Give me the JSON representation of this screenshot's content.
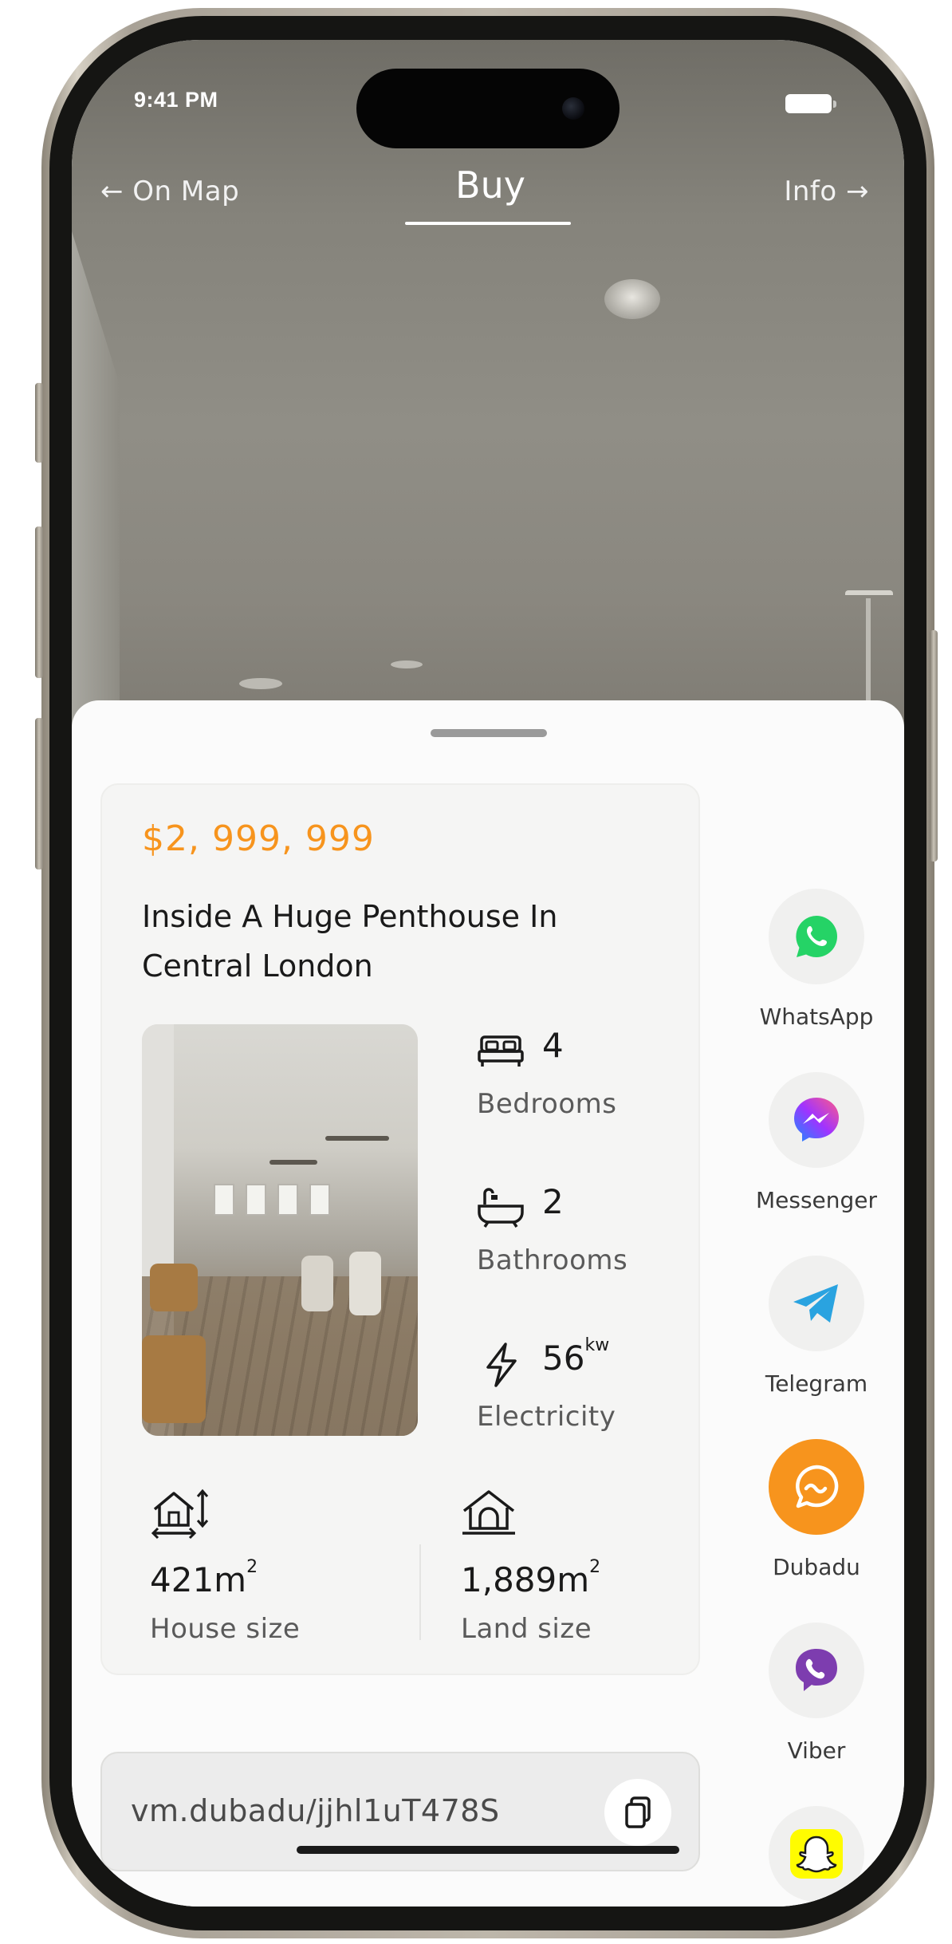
{
  "status_bar": {
    "time": "9:41 PM"
  },
  "nav": {
    "back_label": "← On Map",
    "title": "Buy",
    "info_label": "Info →"
  },
  "listing": {
    "price": "$2, 999, 999",
    "title": "Inside A Huge Penthouse In Central London",
    "bedrooms": {
      "value": "4",
      "label": "Bedrooms"
    },
    "bathrooms": {
      "value": "2",
      "label": "Bathrooms"
    },
    "electricity": {
      "value": "56",
      "unit": "kw",
      "label": "Electricity"
    },
    "house_size": {
      "value": "421m",
      "unit": "2",
      "label": "House size"
    },
    "land_size": {
      "value": "1,889m",
      "unit": "2",
      "label": "Land size"
    }
  },
  "share_link": {
    "url": "vm.dubadu/jjhl1uT478S"
  },
  "share_apps": [
    {
      "label": "WhatsApp",
      "icon": "whatsapp-icon",
      "color": "#25D366"
    },
    {
      "label": "Messenger",
      "icon": "messenger-icon",
      "color": "#A033FF"
    },
    {
      "label": "Telegram",
      "icon": "telegram-icon",
      "color": "#2AA3E0"
    },
    {
      "label": "Dubadu",
      "icon": "dubadu-icon",
      "color": "#F7941D"
    },
    {
      "label": "Viber",
      "icon": "viber-icon",
      "color": "#7D3DAF"
    },
    {
      "label": "",
      "icon": "snapchat-icon",
      "color": "#FFFC00"
    }
  ],
  "colors": {
    "accent": "#F7941D",
    "text": "#1A1A1A"
  }
}
